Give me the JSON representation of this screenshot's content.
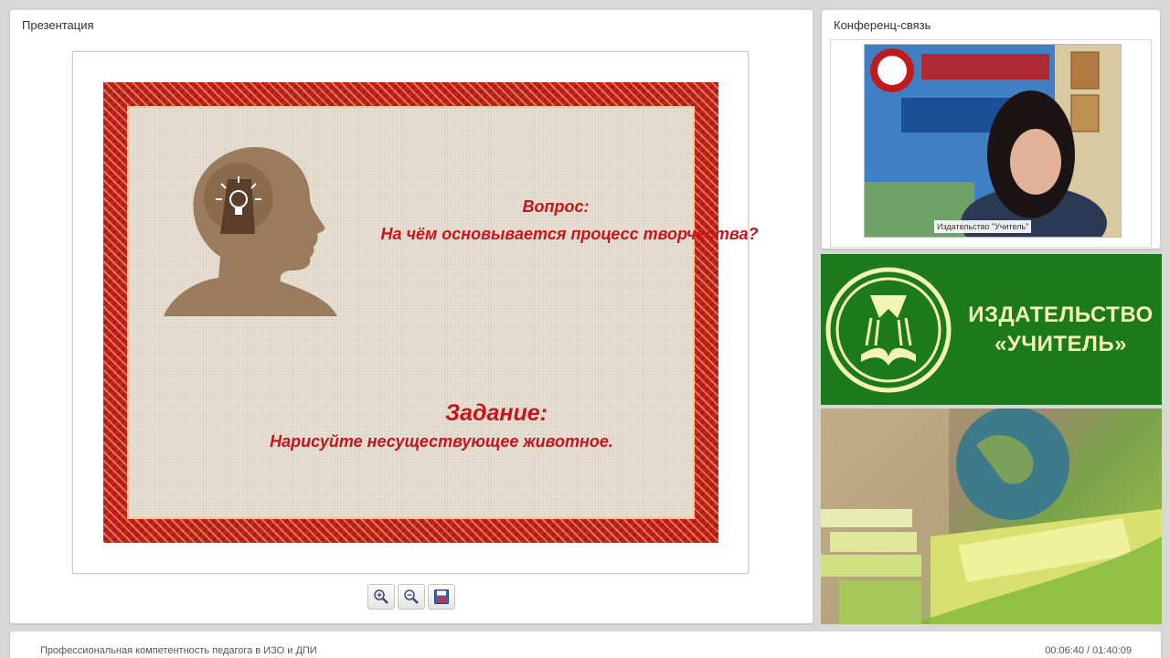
{
  "presentation_panel": {
    "title": "Презентация",
    "slide": {
      "question_title": "Вопрос:",
      "question_text": "На чём основывается процесс творчества?",
      "task_title": "Задание:",
      "task_text": "Нарисуйте несуществующее животное."
    },
    "toolbar": {
      "zoom_in_icon": "zoom-in-icon",
      "zoom_out_icon": "zoom-out-icon",
      "save_icon": "save-icon"
    }
  },
  "conference_panel": {
    "title": "Конференц-связь",
    "video_label": "Издательство \"Учитель\""
  },
  "brand": {
    "line1": "ИЗДАТЕЛЬСТВО",
    "line2": "«УЧИТЕЛЬ»"
  },
  "footer": {
    "course_title": "Профессиональная компетентность педагога в ИЗО и ДПИ",
    "time": "00:06:40 / 01:40:09"
  },
  "colors": {
    "slide_text": "#c8151b",
    "brand_green": "#1c7a1c",
    "brand_text": "#f3f3b3"
  }
}
